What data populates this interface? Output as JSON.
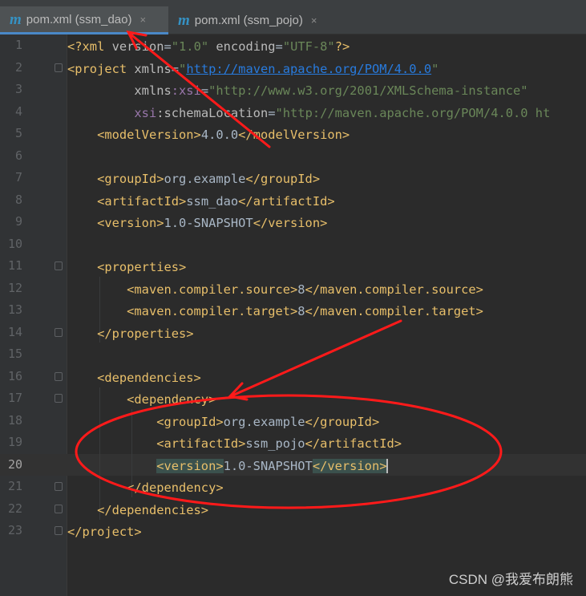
{
  "tabs": [
    {
      "icon": "m",
      "label": "pom.xml (ssm_dao)",
      "close": "×"
    },
    {
      "icon": "m",
      "label": "pom.xml (ssm_pojo)",
      "close": "×"
    }
  ],
  "editor": {
    "current_line": 20,
    "lines": [
      {
        "n": "1"
      },
      {
        "n": "2"
      },
      {
        "n": "3"
      },
      {
        "n": "4"
      },
      {
        "n": "5"
      },
      {
        "n": "6"
      },
      {
        "n": "7"
      },
      {
        "n": "8"
      },
      {
        "n": "9"
      },
      {
        "n": "10"
      },
      {
        "n": "11"
      },
      {
        "n": "12"
      },
      {
        "n": "13"
      },
      {
        "n": "14"
      },
      {
        "n": "15"
      },
      {
        "n": "16"
      },
      {
        "n": "17"
      },
      {
        "n": "18"
      },
      {
        "n": "19"
      },
      {
        "n": "20"
      },
      {
        "n": "21"
      },
      {
        "n": "22"
      },
      {
        "n": "23"
      }
    ],
    "code": {
      "l1": {
        "open": "<?xml ",
        "a1": "version",
        "eq1": "=",
        "v1": "\"1.0\"",
        "sp": " ",
        "a2": "encoding",
        "eq2": "=",
        "v2": "\"UTF-8\"",
        "close": "?>"
      },
      "l2": {
        "open": "<project ",
        "a1": "xmlns",
        "eq": "=",
        "q1": "\"",
        "url": "http://maven.apache.org/POM/4.0.0",
        "q2": "\""
      },
      "l3": {
        "indent": "         ",
        "a1": "xmlns",
        "ns": ":xsi",
        "eq": "=",
        "v": "\"http://www.w3.org/2001/XMLSchema-instance\""
      },
      "l4": {
        "indent": "         ",
        "ns": "xsi",
        "a1": ":schemaLocation",
        "eq": "=",
        "v": "\"http://maven.apache.org/POM/4.0.0 ht"
      },
      "l5": {
        "indent": "    ",
        "o": "<modelVersion>",
        "t": "4.0.0",
        "c": "</modelVersion>"
      },
      "l7": {
        "indent": "    ",
        "o": "<groupId>",
        "t": "org.example",
        "c": "</groupId>"
      },
      "l8": {
        "indent": "    ",
        "o": "<artifactId>",
        "t": "ssm_dao",
        "c": "</artifactId>"
      },
      "l9": {
        "indent": "    ",
        "o": "<version>",
        "t": "1.0-SNAPSHOT",
        "c": "</version>"
      },
      "l11": {
        "indent": "    ",
        "o": "<properties>"
      },
      "l12": {
        "indent": "        ",
        "o": "<maven.compiler.source>",
        "t": "8",
        "c": "</maven.compiler.source>"
      },
      "l13": {
        "indent": "        ",
        "o": "<maven.compiler.target>",
        "t": "8",
        "c": "</maven.compiler.target>"
      },
      "l14": {
        "indent": "    ",
        "c": "</properties>"
      },
      "l16": {
        "indent": "    ",
        "o": "<dependencies>"
      },
      "l17": {
        "indent": "        ",
        "o": "<dependency>"
      },
      "l18": {
        "indent": "            ",
        "o": "<groupId>",
        "t": "org.example",
        "c": "</groupId>"
      },
      "l19": {
        "indent": "            ",
        "o": "<artifactId>",
        "t": "ssm_pojo",
        "c": "</artifactId>"
      },
      "l20": {
        "indent": "            ",
        "o": "<version>",
        "t": "1.0-SNAPSHOT",
        "c": "</version>"
      },
      "l21": {
        "indent": "        ",
        "c": "</dependency>"
      },
      "l22": {
        "indent": "    ",
        "c": "</dependencies>"
      },
      "l23": {
        "c": "</project>"
      }
    }
  },
  "watermark": "CSDN @我爱布朗熊",
  "colors": {
    "annotation": "#ff1a1a",
    "tag": "#e8bf6a",
    "string": "#6a8759",
    "url": "#287bde",
    "namespace": "#9876aa"
  }
}
